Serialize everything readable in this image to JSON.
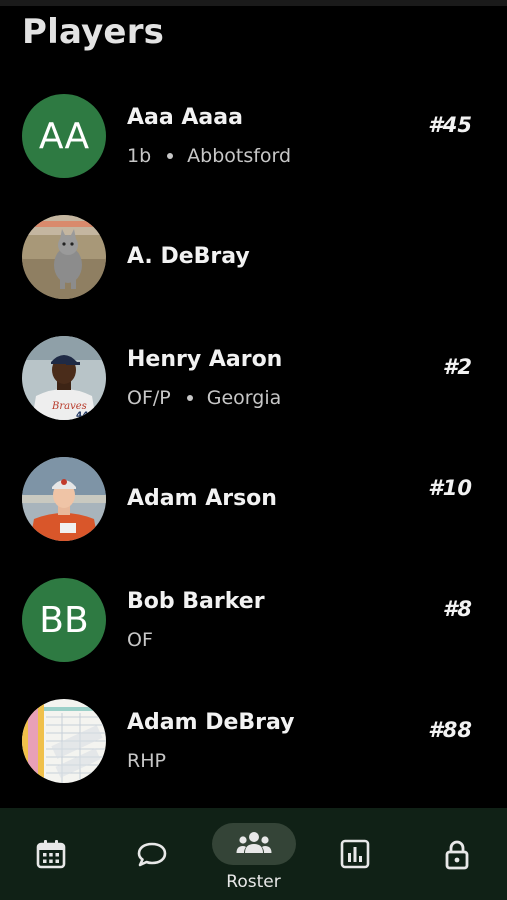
{
  "header": {
    "title": "Players"
  },
  "players": [
    {
      "initials": "AA",
      "name": "Aaa Aaaa",
      "position": "1b",
      "hometown": "Abbotsford",
      "number": "#45"
    },
    {
      "name": "A. DeBray",
      "photo": "photo-cat"
    },
    {
      "name": "Henry Aaron",
      "position": "OF/P",
      "hometown": "Georgia",
      "number": "#2",
      "photo": "photo-baseball-player"
    },
    {
      "name": "Adam Arson",
      "number": "#10",
      "photo": "photo-baseball-player"
    },
    {
      "initials": "BB",
      "name": "Bob Barker",
      "position": "OF",
      "number": "#8"
    },
    {
      "name": "Adam DeBray",
      "position": "RHP",
      "number": "#88",
      "photo": "photo-sample-document"
    }
  ],
  "nav": {
    "items": [
      {
        "icon": "calendar-icon"
      },
      {
        "icon": "chat-bubble-icon"
      },
      {
        "icon": "group-icon",
        "label": "Roster",
        "active": true
      },
      {
        "icon": "bar-chart-icon"
      },
      {
        "icon": "lock-icon"
      }
    ]
  },
  "colors": {
    "background": "#000000",
    "avatar_green": "#2e7a42",
    "nav_bg": "#102116",
    "nav_active": "#344437"
  }
}
